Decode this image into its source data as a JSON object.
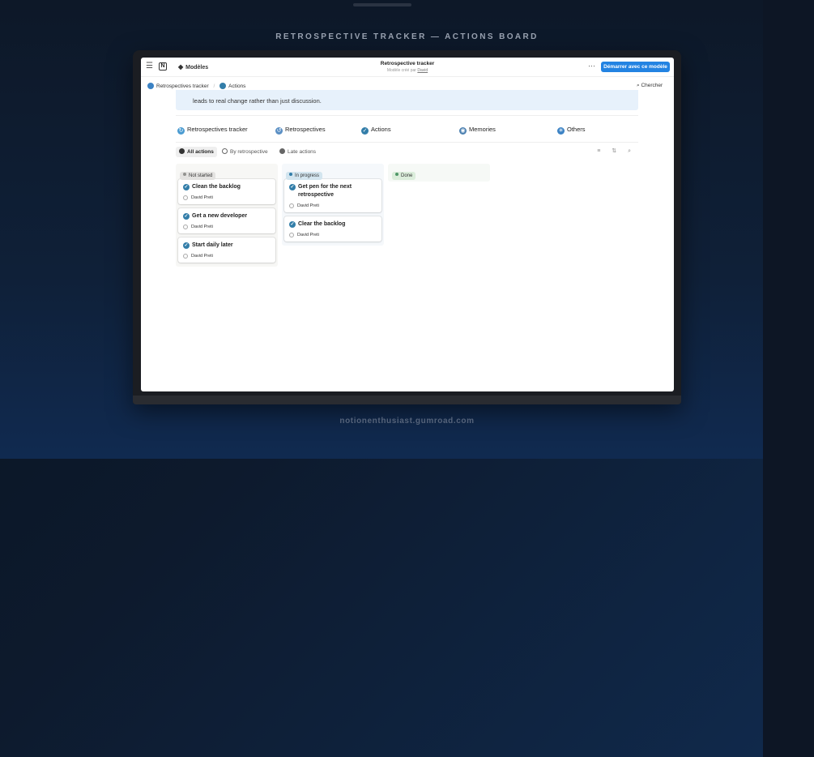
{
  "page": {
    "headline": "RETROSPECTIVE TRACKER — ACTIONS BOARD",
    "footer_url": "notionenthusiast.gumroad.com"
  },
  "topbar": {
    "menu_icon": "menu-icon",
    "logo_icon": "notion-logo",
    "logo_glyph": "N",
    "models_label": "Modèles",
    "doc_title": "Retrospective tracker",
    "doc_subtitle": "Modèle créé par",
    "doc_author": "David",
    "more_glyph": "···",
    "start_button": "Démarrer avec ce modèle"
  },
  "breadcrumb": {
    "items": [
      {
        "label": "Retrospectives tracker",
        "icon": "sync-icon",
        "color": "#3b82c4"
      },
      {
        "label": "Actions",
        "icon": "check-circle-icon",
        "color": "#337ea9"
      }
    ],
    "separator": "/",
    "search_label": "Chercher"
  },
  "callout": {
    "text": "leads to real change rather than just discussion."
  },
  "sections": [
    {
      "label": "Retrospectives tracker",
      "icon": "sync-icon",
      "color": "#4a9bd1"
    },
    {
      "label": "Retrospectives",
      "icon": "history-icon",
      "color": "#5a8fc4"
    },
    {
      "label": "Actions",
      "icon": "check-circle-icon",
      "color": "#337ea9"
    },
    {
      "label": "Memories",
      "icon": "camera-icon",
      "color": "#4a7fb0"
    },
    {
      "label": "Others",
      "icon": "asterisk-icon",
      "color": "#3b82c4"
    }
  ],
  "views": {
    "tabs": [
      {
        "label": "All actions",
        "active": true
      },
      {
        "label": "By retrospective",
        "active": false
      },
      {
        "label": "Late actions",
        "active": false
      }
    ],
    "tools_glyph": "≡ ⇅ ⌕"
  },
  "board": {
    "columns": [
      {
        "status": "Not started",
        "badge_color": "#e3e2e0",
        "dot_color": "#91918e",
        "bg_color": "#f7f7f5",
        "cards": [
          {
            "title": "Clean the backlog",
            "person": "David Preti"
          },
          {
            "title": "Get a new developer",
            "person": "David Preti"
          },
          {
            "title": "Start daily later",
            "person": "David Preti"
          }
        ]
      },
      {
        "status": "In progress",
        "badge_color": "#d3e5ef",
        "dot_color": "#337ea9",
        "bg_color": "#f5f8fb",
        "cards": [
          {
            "title": "Get pen for the next retrospective",
            "person": "David Preti"
          },
          {
            "title": "Clear the backlog",
            "person": "David Preti"
          }
        ]
      },
      {
        "status": "Done",
        "badge_color": "#dbeddb",
        "dot_color": "#4f9768",
        "bg_color": "#f6f9f6",
        "cards": []
      }
    ]
  },
  "check_glyph": "✓"
}
